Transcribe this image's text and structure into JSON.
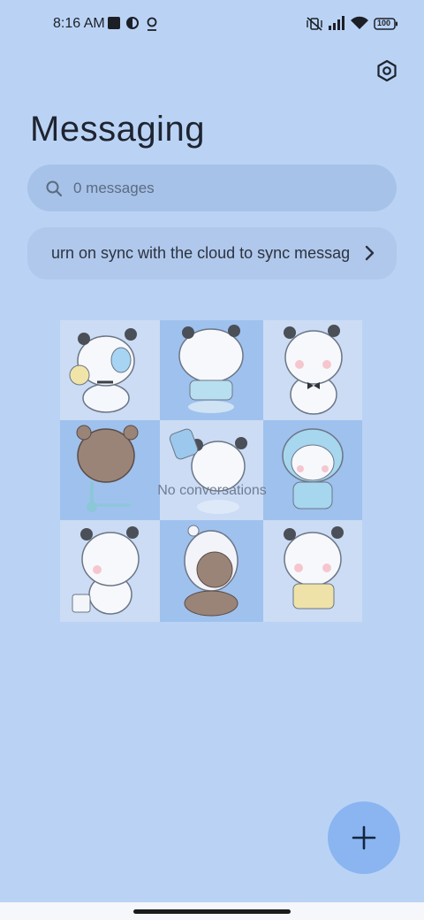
{
  "status_bar": {
    "time": "8:16 AM",
    "battery": "100"
  },
  "header": {
    "title": "Messaging"
  },
  "search": {
    "placeholder": "0 messages"
  },
  "sync_banner": {
    "text": "urn on sync with the cloud to sync messages"
  },
  "empty_state": {
    "text": "No conversations"
  },
  "colors": {
    "background": "#bad3f5",
    "search_bg": "#a7c2e8",
    "fab": "#8ab5f1"
  },
  "icons": [
    "stop-icon",
    "half-circle-icon",
    "location-pin-icon",
    "vibrate-mute-icon",
    "signal-icon",
    "wifi-icon",
    "battery-icon",
    "settings-icon",
    "search-icon",
    "chevron-right-icon",
    "plus-icon"
  ]
}
